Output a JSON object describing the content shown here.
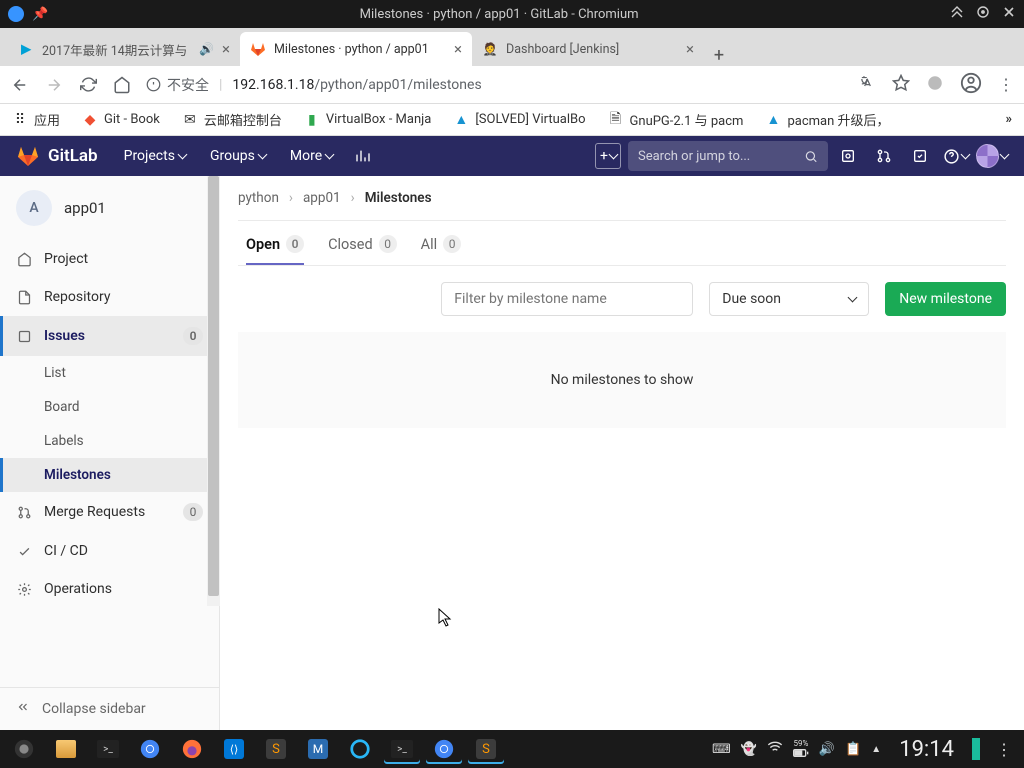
{
  "os": {
    "window_title": "Milestones · python / app01 · GitLab - Chromium"
  },
  "browser": {
    "tabs": [
      {
        "label": "2017年最新 14期云计算与",
        "favicon": "bilibili",
        "audio": true
      },
      {
        "label": "Milestones · python / app01",
        "favicon": "gitlab",
        "active": true
      },
      {
        "label": "Dashboard [Jenkins]",
        "favicon": "jenkins"
      }
    ],
    "url_insecure_label": "不安全",
    "url_host": "192.168.1.18",
    "url_path": "/python/app01/milestones",
    "bookmarks": [
      {
        "label": "应用",
        "icon": "apps"
      },
      {
        "label": "Git - Book",
        "icon": "git"
      },
      {
        "label": "云邮箱控制台",
        "icon": "mail"
      },
      {
        "label": "VirtualBox - Manja",
        "icon": "vbox"
      },
      {
        "label": "[SOLVED] VirtualBo",
        "icon": "arch"
      },
      {
        "label": "GnuPG-2.1 与 pacm",
        "icon": "page"
      },
      {
        "label": "pacman 升级后，",
        "icon": "arch"
      }
    ]
  },
  "gitlab": {
    "brand": "GitLab",
    "nav": {
      "projects": "Projects",
      "groups": "Groups",
      "more": "More"
    },
    "search_placeholder": "Search or jump to...",
    "project": {
      "initial": "A",
      "name": "app01"
    },
    "sidebar": {
      "project": "Project",
      "repository": "Repository",
      "issues": "Issues",
      "issues_count": "0",
      "issues_subs": {
        "list": "List",
        "board": "Board",
        "labels": "Labels",
        "milestones": "Milestones"
      },
      "merge_requests": "Merge Requests",
      "mr_count": "0",
      "cicd": "CI / CD",
      "operations": "Operations",
      "collapse": "Collapse sidebar"
    },
    "breadcrumb": {
      "a": "python",
      "b": "app01",
      "c": "Milestones"
    },
    "tabs": {
      "open": "Open",
      "open_count": "0",
      "closed": "Closed",
      "closed_count": "0",
      "all": "All",
      "all_count": "0"
    },
    "filter_placeholder": "Filter by milestone name",
    "sort_label": "Due soon",
    "new_button": "New milestone",
    "empty_message": "No milestones to show"
  },
  "taskbar": {
    "clock": "19:14",
    "battery": "59%"
  }
}
